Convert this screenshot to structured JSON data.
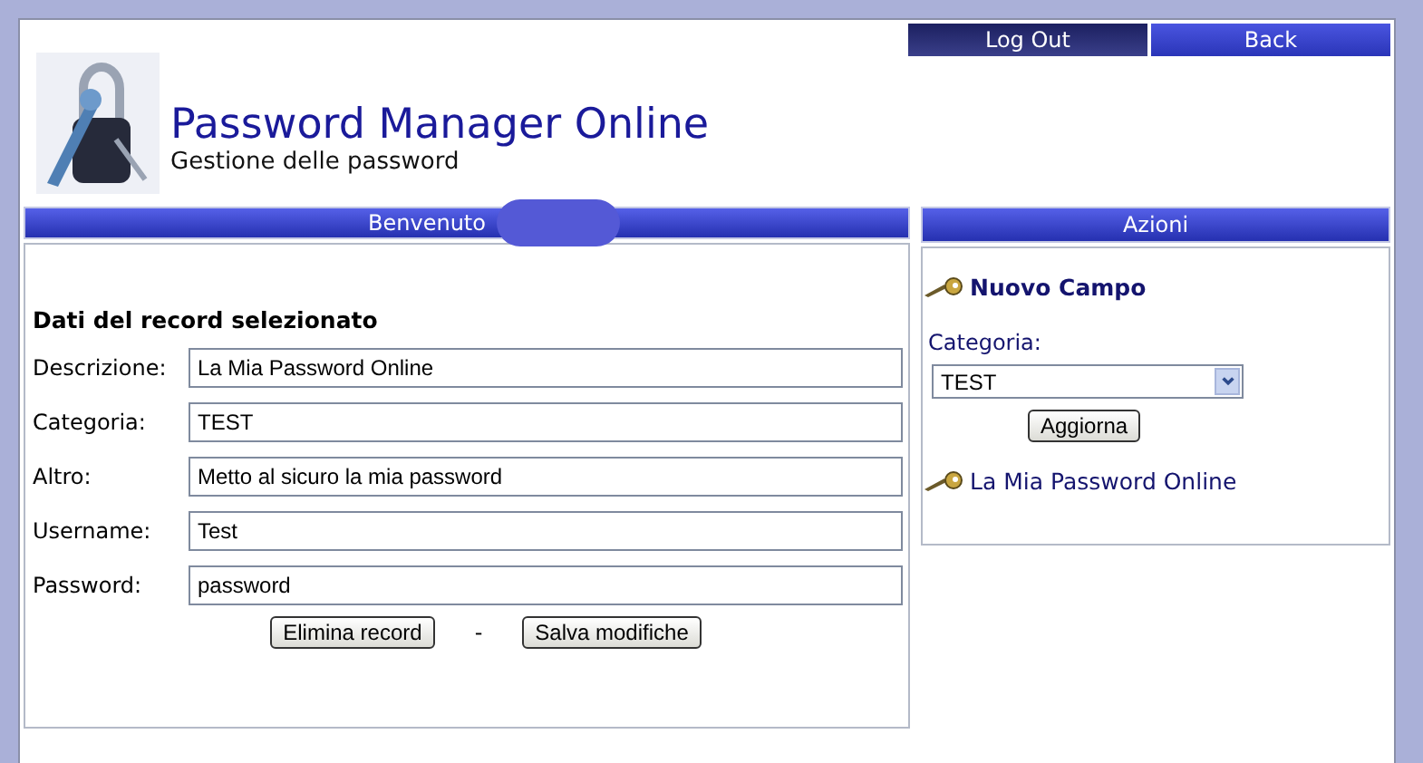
{
  "nav": [
    {
      "label": "Log Out",
      "selected": true
    },
    {
      "label": "Back",
      "selected": false
    }
  ],
  "header": {
    "title": "Password Manager Online",
    "subtitle": "Gestione delle password"
  },
  "main": {
    "heading": "Benvenuto",
    "section_title": "Dati del record selezionato",
    "fields": [
      {
        "label": "Descrizione:",
        "value": "La Mia Password Online"
      },
      {
        "label": "Categoria:",
        "value": "TEST"
      },
      {
        "label": "Altro:",
        "value": "Metto al sicuro la mia password"
      },
      {
        "label": "Username:",
        "value": "Test"
      },
      {
        "label": "Password:",
        "value": "password"
      }
    ],
    "buttons": [
      "Elimina record",
      "Salva modifiche"
    ],
    "separator": "-"
  },
  "actions": {
    "heading": "Azioni",
    "new_link": "Nuovo Campo",
    "category_label": "Categoria:",
    "category_value": "TEST",
    "update_button": "Aggiorna",
    "records": [
      "La Mia Password Online"
    ]
  }
}
